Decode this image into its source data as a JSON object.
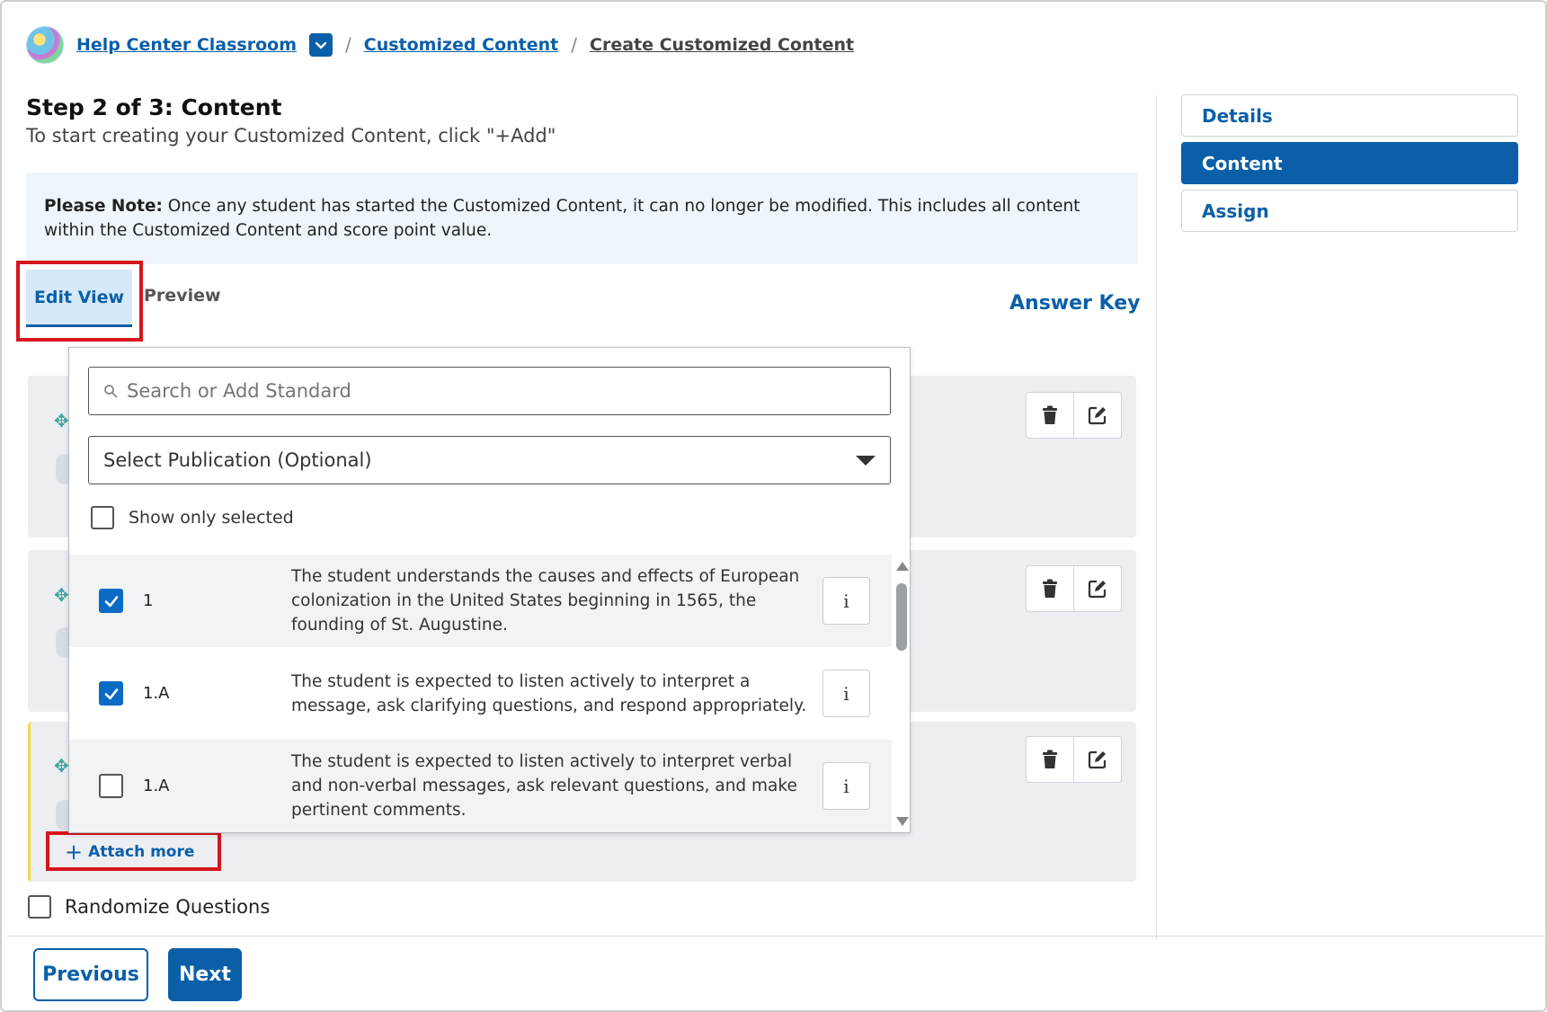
{
  "breadcrumb": {
    "classroom": "Help Center Classroom",
    "customized": "Customized Content",
    "current": "Create Customized Content",
    "separator": "/"
  },
  "step": {
    "title": "Step 2 of 3: Content",
    "subtitle": "To start creating your Customized Content, click \"+Add\""
  },
  "note": {
    "label": "Please Note:",
    "text": " Once any student has started the Customized Content, it can no longer be modified. This includes all content within the Customized Content and score point value."
  },
  "tabs": {
    "edit": "Edit View",
    "preview": "Preview"
  },
  "answer_key": "Answer Key",
  "standards_dropdown": {
    "search_placeholder": "Search or Add Standard",
    "publication_select": "Select Publication (Optional)",
    "show_only_selected": "Show only selected",
    "info_glyph": "i",
    "items": [
      {
        "code": "1",
        "checked": true,
        "description": "The student understands the causes and effects of European colonization in the United States beginning in 1565, the founding of St. Augustine."
      },
      {
        "code": "1.A",
        "checked": true,
        "description": "The student is expected to listen actively to interpret a message, ask clarifying questions, and respond appropriately."
      },
      {
        "code": "1.A",
        "checked": false,
        "description": "The student is expected to listen actively to interpret verbal and non-verbal messages, ask relevant questions, and make pertinent comments."
      }
    ]
  },
  "attach_more": "Attach more",
  "randomize": "Randomize Questions",
  "sidebar": {
    "items": [
      {
        "label": "Details",
        "active": false
      },
      {
        "label": "Content",
        "active": true
      },
      {
        "label": "Assign",
        "active": false
      }
    ]
  },
  "footer": {
    "previous": "Previous",
    "next": "Next"
  },
  "colors": {
    "accent": "#0b5fa8",
    "highlight_red": "#d6141c",
    "checkbox_blue": "#0b6bc4",
    "note_bg": "#eef6fc"
  },
  "icons": [
    "globe-icon",
    "chevron-down-icon",
    "search-icon",
    "caret-down-icon",
    "check-icon",
    "info-icon",
    "trash-icon",
    "edit-icon",
    "drag-icon",
    "plus-icon"
  ]
}
